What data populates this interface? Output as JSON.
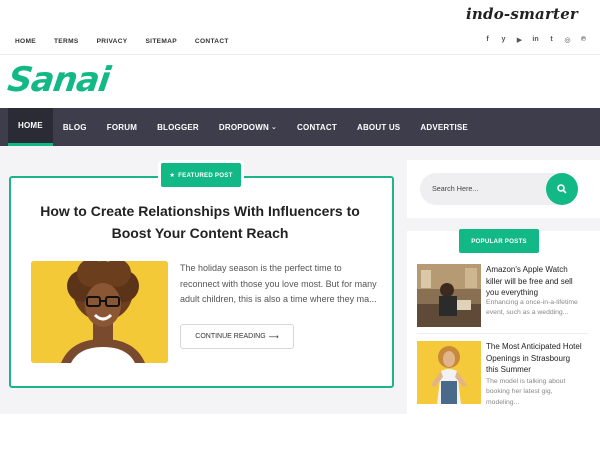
{
  "watermark": "indo-smarter",
  "top_links": [
    "HOME",
    "TERMS",
    "PRIVACY",
    "SITEMAP",
    "CONTACT"
  ],
  "social_icons": [
    "facebook-icon",
    "twitter-icon",
    "youtube-icon",
    "linkedin-icon",
    "tumblr-icon",
    "instagram-icon",
    "pinterest-icon"
  ],
  "social_glyphs": [
    "f",
    "y",
    "▶",
    "in",
    "t",
    "◎",
    "℗"
  ],
  "logo": "Sanai",
  "nav": {
    "items": [
      "HOME",
      "BLOG",
      "FORUM",
      "BLOGGER",
      "DROPDOWN",
      "CONTACT",
      "ABOUT US",
      "ADVERTISE"
    ],
    "active": "HOME",
    "dropdown_item": "DROPDOWN"
  },
  "featured": {
    "badge": "FEATURED POST",
    "title": "How to Create Relationships With Influencers to Boost Your Content Reach",
    "excerpt": "The holiday season is the perfect time to reconnect with those you love most. But for many adult children, this is also a time where they ma...",
    "read_more": "CONTINUE READING"
  },
  "search": {
    "placeholder": "Search Here..."
  },
  "popular": {
    "badge": "POPULAR POSTS",
    "posts": [
      {
        "title": "Amazon's Apple Watch killer will be free and sell you everything",
        "snippet": "Enhancing a once-in-a-lifetime event, such as a wedding..."
      },
      {
        "title": "The Most Anticipated Hotel Openings in Strasbourg this Summer",
        "snippet": "The model is talking about booking her latest gig, modeling..."
      }
    ]
  },
  "colors": {
    "accent": "#12b886",
    "nav_bg": "#3d3d4c",
    "nav_active": "#2b2b36"
  }
}
